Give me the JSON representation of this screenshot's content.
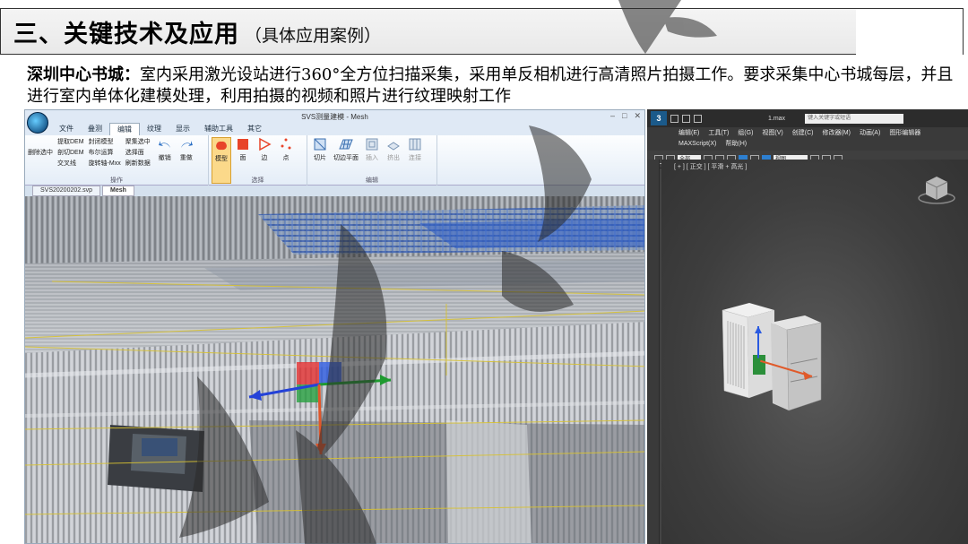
{
  "slide": {
    "title": "三、关键技术及应用",
    "subtitle": "（具体应用案例）",
    "desc_lead": "深圳中心书城：",
    "desc_body": "室内采用激光设站进行360°全方位扫描采集，采用单反相机进行高清照片拍摄工作。要求采集中心书城每层，并且进行室内单体化建模处理，利用拍摄的视频和照片进行纹理映射工作"
  },
  "svs": {
    "window_title": "SVS测量建模 - Mesh",
    "menus": [
      "文件",
      "叠测",
      "编辑",
      "纹理",
      "显示",
      "辅助工具",
      "其它"
    ],
    "active_menu": "编辑",
    "ops_small": [
      "删除选中",
      "提取DEM",
      "剖切DEM",
      "交叉线",
      "封闭模型",
      "布尔运算",
      "旋转轴-Mxx",
      "聚集选中",
      "选择面",
      "刷新数据"
    ],
    "undo": "撤销",
    "redo": "重做",
    "group_ops": "操作",
    "select_tools": [
      "模型",
      "面",
      "边",
      "点"
    ],
    "group_select": "选择",
    "edit_tools": [
      "切片",
      "切边平面",
      "插入",
      "挤出",
      "连接"
    ],
    "group_edit": "编辑",
    "doc_tabs": [
      "SVS20200202.svp",
      "Mesh"
    ]
  },
  "max": {
    "logo": "3",
    "file": "1.max",
    "search_placeholder": "键入关键字或短语",
    "menus": [
      "编辑(E)",
      "工具(T)",
      "组(G)",
      "视图(V)",
      "创建(C)",
      "修改器(M)",
      "动画(A)",
      "图形编辑器",
      "MAXScript(X)",
      "帮助(H)"
    ],
    "view_select": "视图",
    "toolbar_filter": "全部",
    "viewport_label": "[ + ] [ 正交 ] [ 平滑 + 高光 ]"
  },
  "colors": {
    "accent": "#1b5a8a",
    "ribbon_bg": "#e4edf7",
    "max_bg": "#3e3e3e"
  }
}
